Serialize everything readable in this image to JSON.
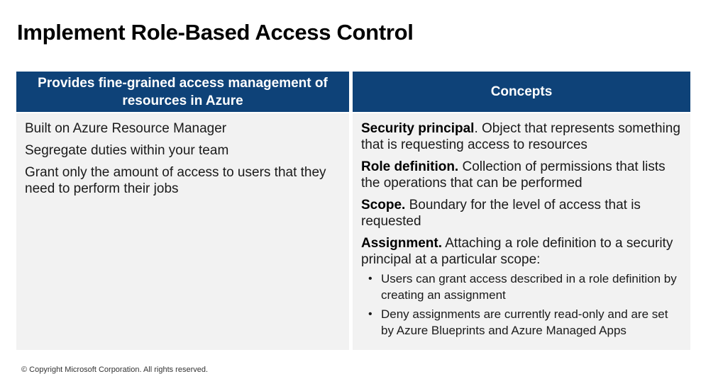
{
  "title": "Implement Role-Based Access Control",
  "left": {
    "header": "Provides fine-grained access management of resources in Azure",
    "items": [
      "Built on Azure Resource Manager",
      "Segregate duties within your team",
      "Grant only the amount of access to users that they need to perform their jobs"
    ]
  },
  "right": {
    "header": "Concepts",
    "concepts": [
      {
        "term": "Security principal",
        "text": ". Object that represents something that is requesting access to resources"
      },
      {
        "term": "Role definition.",
        "text": " Collection of permissions that lists the operations that can be performed"
      },
      {
        "term": "Scope.",
        "text": " Boundary for the level of access that is requested"
      },
      {
        "term": "Assignment.",
        "text": " Attaching a role definition to a security principal at a particular scope:"
      }
    ],
    "bullets": [
      "Users can grant access described in a role definition by creating an assignment",
      "Deny assignments are currently read-only and are set by Azure Blueprints and Azure Managed Apps"
    ]
  },
  "footer": "© Copyright Microsoft Corporation. All rights reserved."
}
